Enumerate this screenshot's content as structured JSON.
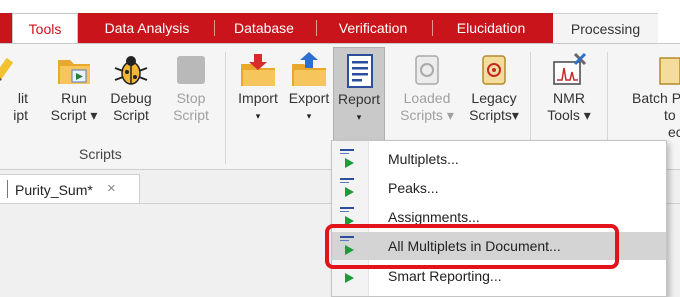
{
  "tabs": [
    {
      "label": "Tools",
      "active": true
    },
    {
      "label": "Data Analysis"
    },
    {
      "label": "Database"
    },
    {
      "label": "Verification"
    },
    {
      "label": "Elucidation"
    },
    {
      "label": "Processing"
    }
  ],
  "ribbon": {
    "buttons": {
      "edit_script": {
        "line1": "lit",
        "line2": "ipt"
      },
      "run_script": {
        "line1": "Run",
        "line2": "Script"
      },
      "debug_script": {
        "line1": "Debug",
        "line2": "Script"
      },
      "stop_script": {
        "line1": "Stop",
        "line2": "Script"
      },
      "import": {
        "line1": "Import"
      },
      "export": {
        "line1": "Export"
      },
      "report": {
        "line1": "Report"
      },
      "loaded_scripts": {
        "line1": "Loaded",
        "line2": "Scripts"
      },
      "legacy_scripts": {
        "line1": "Legacy",
        "line2": "Scripts"
      },
      "nmr_tools": {
        "line1": "NMR",
        "line2": "Tools"
      },
      "batch": {
        "line1": "Batch P",
        "line2": "to",
        "line3": "ec"
      }
    },
    "groups": {
      "scripts": "Scripts"
    }
  },
  "document_tab": {
    "name": "Purity_Sum*",
    "close": "×"
  },
  "report_menu": {
    "items": [
      {
        "label": "Multiplets..."
      },
      {
        "label": "Peaks..."
      },
      {
        "label": "Assignments..."
      },
      {
        "label": "All Multiplets in Document...",
        "highlighted": true
      },
      {
        "label": "Smart Reporting..."
      }
    ]
  },
  "colors": {
    "accent": "#c8141a",
    "annotation": "#e2131b",
    "menu_highlight": "#d4d4d4",
    "play_icon": "#1f9a3a"
  }
}
